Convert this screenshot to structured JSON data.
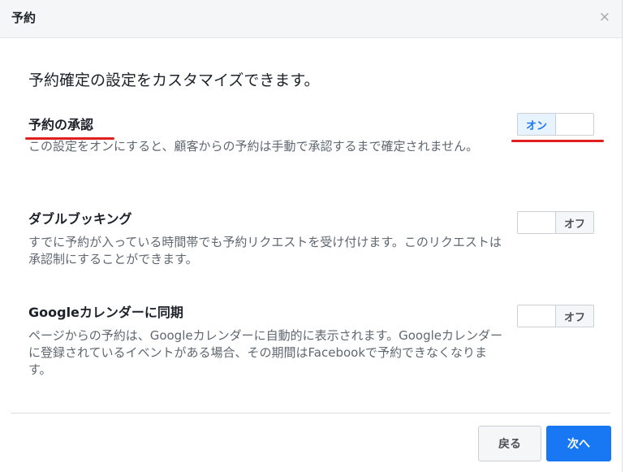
{
  "dialog": {
    "title": "予約",
    "close_icon": "×"
  },
  "intro": "予約確定の設定をカスタマイズできます。",
  "settings": [
    {
      "label": "予約の承認",
      "description": "この設定をオンにすると、顧客からの予約は手動で承認するまで確定されません。",
      "toggle_state": "on",
      "on_label": "オン",
      "off_label": ""
    },
    {
      "label": "ダブルブッキング",
      "description": "すでに予約が入っている時間帯でも予約リクエストを受け付けます。このリクエストは承認制にすることができます。",
      "toggle_state": "off",
      "on_label": "",
      "off_label": "オフ"
    },
    {
      "label": "Googleカレンダーに同期",
      "description": "ページからの予約は、Googleカレンダーに自動的に表示されます。Googleカレンダーに登録されているイベントがある場合、その期間はFacebookで予約できなくなります。",
      "toggle_state": "off",
      "on_label": "",
      "off_label": "オフ"
    }
  ],
  "footer": {
    "back_label": "戻る",
    "next_label": "次へ"
  },
  "colors": {
    "primary": "#1877f2",
    "annotation": "#e0201e"
  }
}
